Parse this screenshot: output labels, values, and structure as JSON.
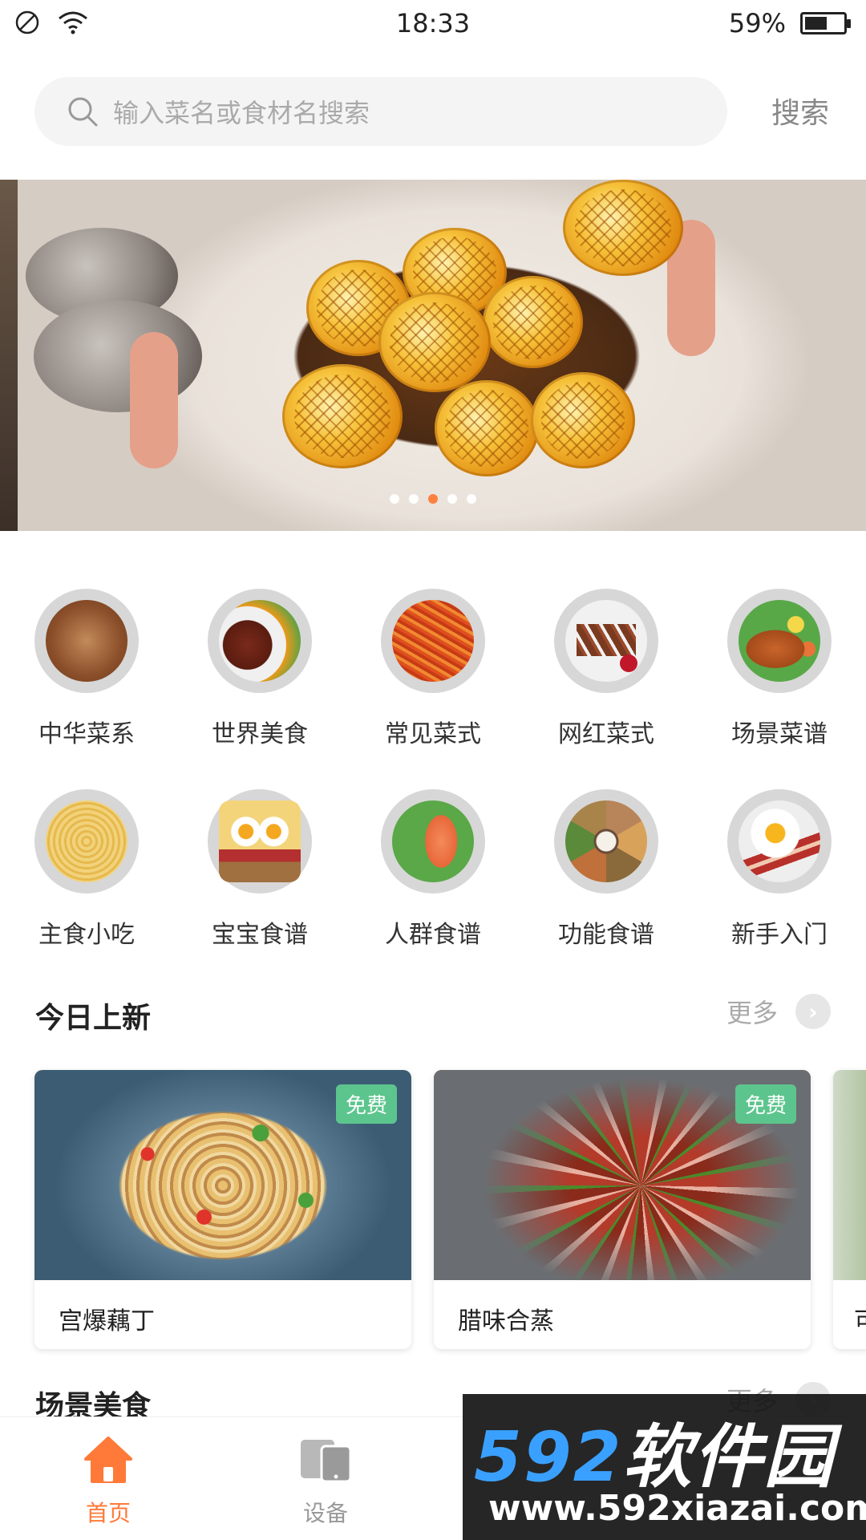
{
  "status_bar": {
    "time": "18:33",
    "battery_percent": "59%",
    "battery_level": 0.59
  },
  "search": {
    "placeholder": "输入菜名或食材名搜索",
    "button_label": "搜索"
  },
  "banner": {
    "slide_count": 5,
    "active_index": 2
  },
  "categories": [
    {
      "label": "中华菜系",
      "icon": "steamer-basket-icon"
    },
    {
      "label": "世界美食",
      "icon": "steak-plate-icon"
    },
    {
      "label": "常见菜式",
      "icon": "shredded-dish-icon"
    },
    {
      "label": "网红菜式",
      "icon": "skewers-icon"
    },
    {
      "label": "场景菜谱",
      "icon": "roast-platter-icon"
    },
    {
      "label": "主食小吃",
      "icon": "noodle-bowl-icon"
    },
    {
      "label": "宝宝食谱",
      "icon": "egg-toast-icon"
    },
    {
      "label": "人群食谱",
      "icon": "salmon-salad-icon"
    },
    {
      "label": "功能食谱",
      "icon": "condiment-tray-icon"
    },
    {
      "label": "新手入门",
      "icon": "fried-egg-bacon-icon"
    }
  ],
  "today_new": {
    "title": "今日上新",
    "more_label": "更多",
    "cards": [
      {
        "name": "宫爆藕丁",
        "badge": "免费"
      },
      {
        "name": "腊味合蒸",
        "badge": "免费"
      },
      {
        "name": "可"
      }
    ]
  },
  "scene_food": {
    "title": "场景美食",
    "more_label": "更多"
  },
  "tabbar": {
    "items": [
      {
        "label": "首页",
        "active": true,
        "icon": "home-icon"
      },
      {
        "label": "设备",
        "active": false,
        "icon": "devices-icon"
      }
    ],
    "active_color": "#ff7a38",
    "inactive_color": "#999999"
  },
  "watermark": {
    "brand_num": "592",
    "brand_text": "软件园",
    "url": "www.592xiazai.com"
  }
}
